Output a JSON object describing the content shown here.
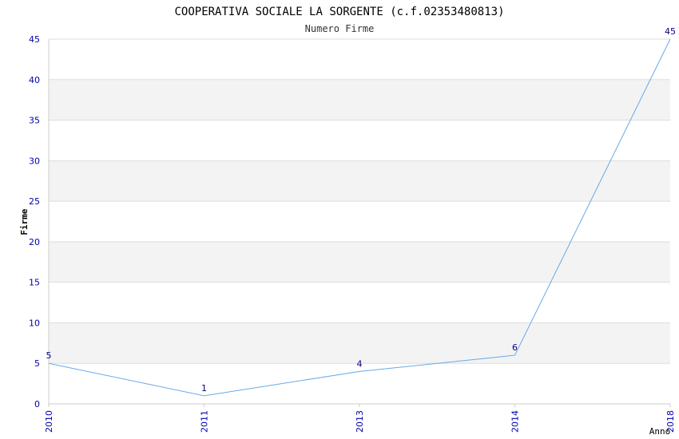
{
  "chart_data": {
    "type": "line",
    "title": "COOPERATIVA SOCIALE LA SORGENTE (c.f.02353480813)",
    "subtitle": "Numero Firme",
    "xlabel": "Anno",
    "ylabel": "Firme",
    "categories": [
      "2010",
      "2011",
      "2013",
      "2014",
      "2018"
    ],
    "series": [
      {
        "values": [
          5,
          1,
          4,
          6,
          45
        ]
      }
    ],
    "ylim": [
      0,
      45
    ],
    "yticks": [
      "0",
      "5",
      "10",
      "15",
      "20",
      "25",
      "30",
      "35",
      "40",
      "45"
    ],
    "grid": true,
    "colors": {
      "line": "#6aa8e6",
      "tick_text": "#0000aa",
      "data_label": "#000080",
      "band": "#f3f3f3",
      "grid": "#dddddd"
    }
  }
}
